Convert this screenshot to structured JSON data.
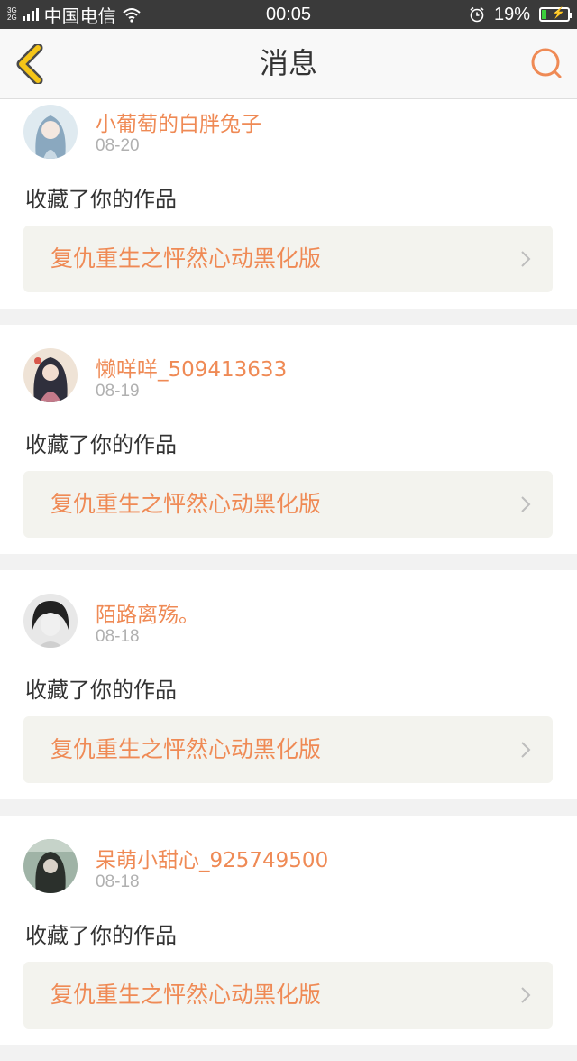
{
  "status_bar": {
    "network_top": "3G",
    "network_bottom": "2G",
    "carrier": "中国电信",
    "time": "00:05",
    "battery_percent": "19%",
    "battery_level": 0.19
  },
  "header": {
    "title": "消息",
    "back_icon": "chevron-left-icon",
    "search_icon": "search-icon"
  },
  "colors": {
    "accent": "#ef8a55",
    "back_arrow": "#f5c518",
    "page_bg": "#f2f2f2",
    "link_bg": "#f3f3ee"
  },
  "messages": [
    {
      "username": "小葡萄的白胖兔子",
      "date": "08-20",
      "action": "收藏了你的作品",
      "work_title": "复仇重生之怦然心动黑化版"
    },
    {
      "username": "懒咩咩_509413633",
      "date": "08-19",
      "action": "收藏了你的作品",
      "work_title": "复仇重生之怦然心动黑化版"
    },
    {
      "username": "陌路离殇。",
      "date": "08-18",
      "action": "收藏了你的作品",
      "work_title": "复仇重生之怦然心动黑化版"
    },
    {
      "username": "呆萌小甜心_925749500",
      "date": "08-18",
      "action": "收藏了你的作品",
      "work_title": "复仇重生之怦然心动黑化版"
    }
  ]
}
